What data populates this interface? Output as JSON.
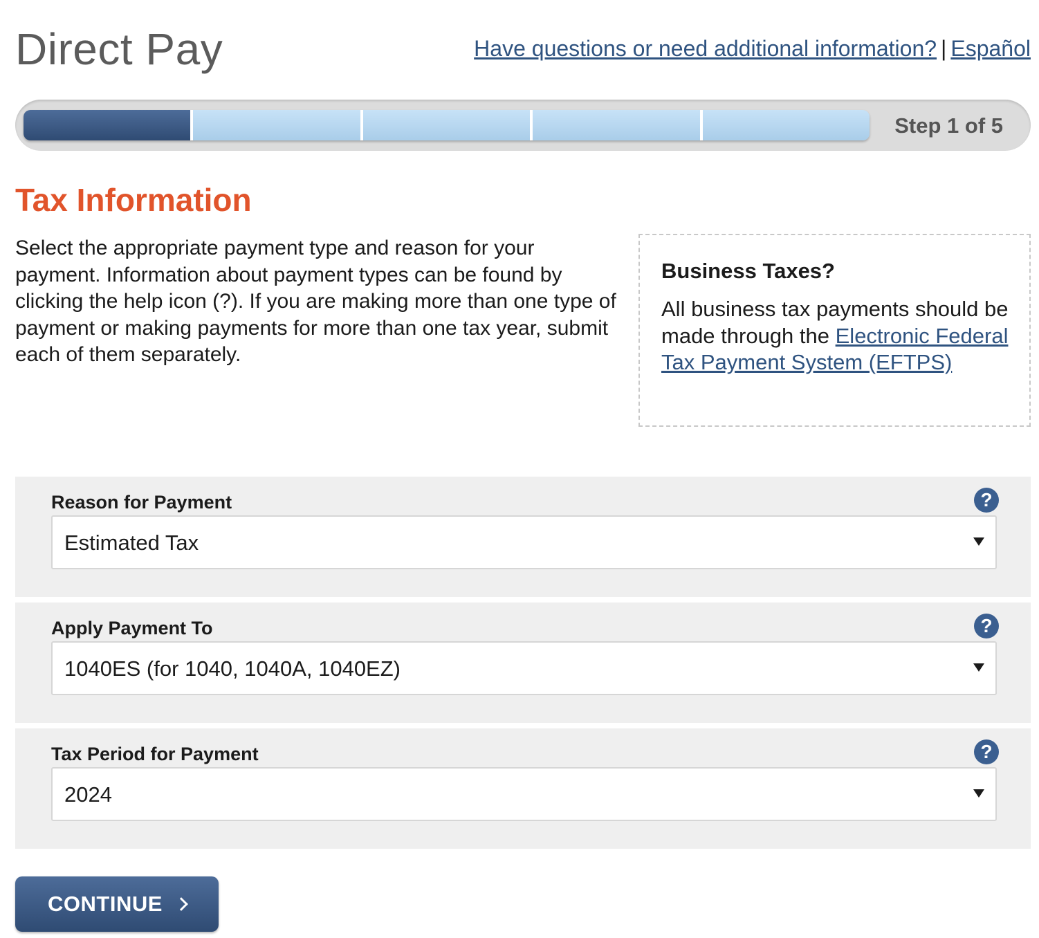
{
  "header": {
    "title": "Direct Pay",
    "help_link": "Have questions or need additional information?",
    "separator": "|",
    "language_link": "Español"
  },
  "progress": {
    "step_label": "Step 1 of 5",
    "current_step": 1,
    "total_steps": 5
  },
  "section": {
    "title": "Tax Information",
    "intro": "Select the appropriate payment type and reason for your payment. Information about payment types can be found by clicking the help icon (?). If you are making more than one type of payment or making payments for more than one tax year, submit each of them separately."
  },
  "aside": {
    "title": "Business Taxes?",
    "body_prefix": "All business tax payments should be made through the ",
    "link": "Electronic Federal Tax Payment System (EFTPS)"
  },
  "fields": [
    {
      "label": "Reason for Payment",
      "value": "Estimated Tax",
      "help": "?"
    },
    {
      "label": "Apply Payment To",
      "value": "1040ES (for 1040, 1040A, 1040EZ)",
      "help": "?"
    },
    {
      "label": "Tax Period for Payment",
      "value": "2024",
      "help": "?"
    }
  ],
  "actions": {
    "continue_label": "CONTINUE"
  },
  "colors": {
    "accent_title": "#e1542b",
    "link": "#2f5380",
    "progress_active": "#3b5a85",
    "progress_inactive": "#b9d8f0",
    "help_icon": "#3b5f90",
    "panel_bg": "#efefef"
  }
}
